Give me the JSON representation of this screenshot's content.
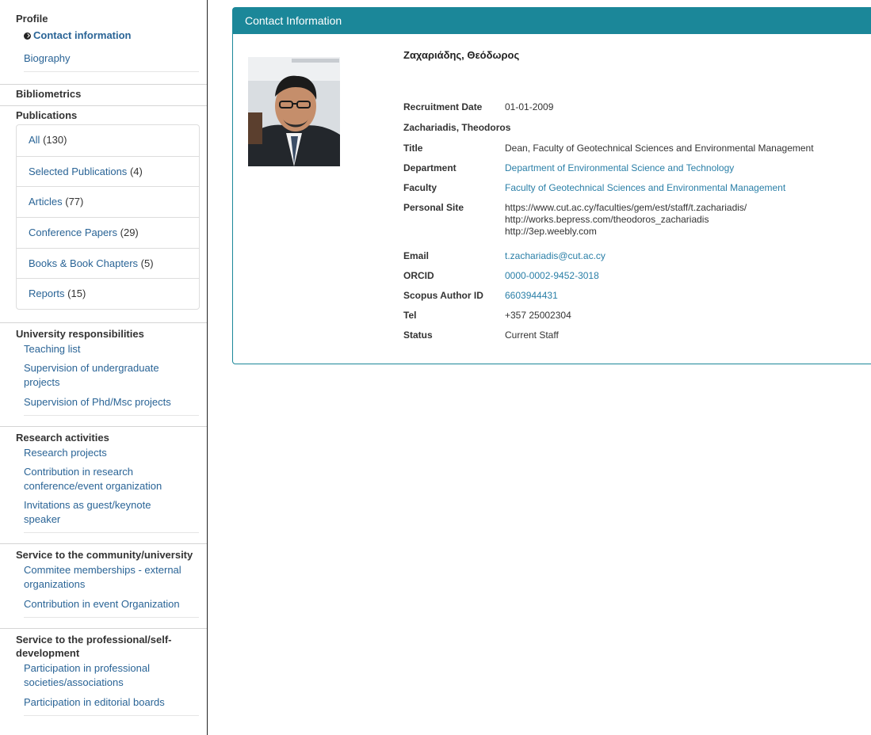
{
  "sidebar": {
    "profile_title": "Profile",
    "profile_items": [
      {
        "label": "Contact information",
        "active": true
      },
      {
        "label": "Biography"
      }
    ],
    "bibliometrics_title": "Bibliometrics",
    "publications_title": "Publications",
    "publications": [
      {
        "label": "All",
        "count": "(130)"
      },
      {
        "label": "Selected Publications",
        "count": "(4)"
      },
      {
        "label": "Articles",
        "count": "(77)"
      },
      {
        "label": "Conference Papers",
        "count": "(29)"
      },
      {
        "label": "Books & Book Chapters",
        "count": "(5)"
      },
      {
        "label": "Reports",
        "count": "(15)"
      }
    ],
    "university_title": "University responsibilities",
    "university_items": [
      {
        "label": "Teaching list"
      },
      {
        "label": "Supervision of undergraduate projects"
      },
      {
        "label": "Supervision of Phd/Msc projects"
      }
    ],
    "research_title": "Research activities",
    "research_items": [
      {
        "label": "Research projects"
      },
      {
        "label": "Contribution in research conference/event organization"
      },
      {
        "label": "Invitations as guest/keynote speaker"
      }
    ],
    "community_title": "Service to the community/university",
    "community_items": [
      {
        "label": "Commitee memberships - external organizations"
      },
      {
        "label": "Contribution in event Organization"
      }
    ],
    "professional_title": "Service to the professional/self-development",
    "professional_items": [
      {
        "label": "Participation in professional societies/associations"
      },
      {
        "label": "Participation in editorial boards"
      }
    ]
  },
  "panel": {
    "title": "Contact Information",
    "name_greek": "Ζαχαριάδης, Θεόδωρος",
    "recruitment_label": "Recruitment Date",
    "recruitment_value": "01-01-2009",
    "name_latin": "Zachariadis, Theodoros",
    "fields": [
      {
        "key": "Title",
        "value": "Dean, Faculty of Geotechnical Sciences and Environmental Management",
        "link": false
      },
      {
        "key": "Department",
        "value": "Department of Environmental Science and Technology",
        "link": true
      },
      {
        "key": "Faculty",
        "value": "Faculty of Geotechnical Sciences and Environmental Management",
        "link": true
      },
      {
        "key": "Personal Site",
        "value": "",
        "link": false
      },
      {
        "key": "Email",
        "value": "t.zachariadis@cut.ac.cy",
        "link": true
      },
      {
        "key": "ORCID",
        "value": "0000-0002-9452-3018",
        "link": true
      },
      {
        "key": "Scopus Author ID",
        "value": "6603944431",
        "link": true
      },
      {
        "key": "Tel",
        "value": "+357 25002304",
        "link": false
      },
      {
        "key": "Status",
        "value": "Current Staff",
        "link": false
      }
    ],
    "personal_sites": [
      "https://www.cut.ac.cy/faculties/gem/est/staff/t.zachariadis/",
      "http://works.bepress.com/theodoros_zachariadis",
      "http://3ep.weebly.com"
    ]
  },
  "colors": {
    "accent": "#1b8799",
    "link": "#2a6496"
  }
}
